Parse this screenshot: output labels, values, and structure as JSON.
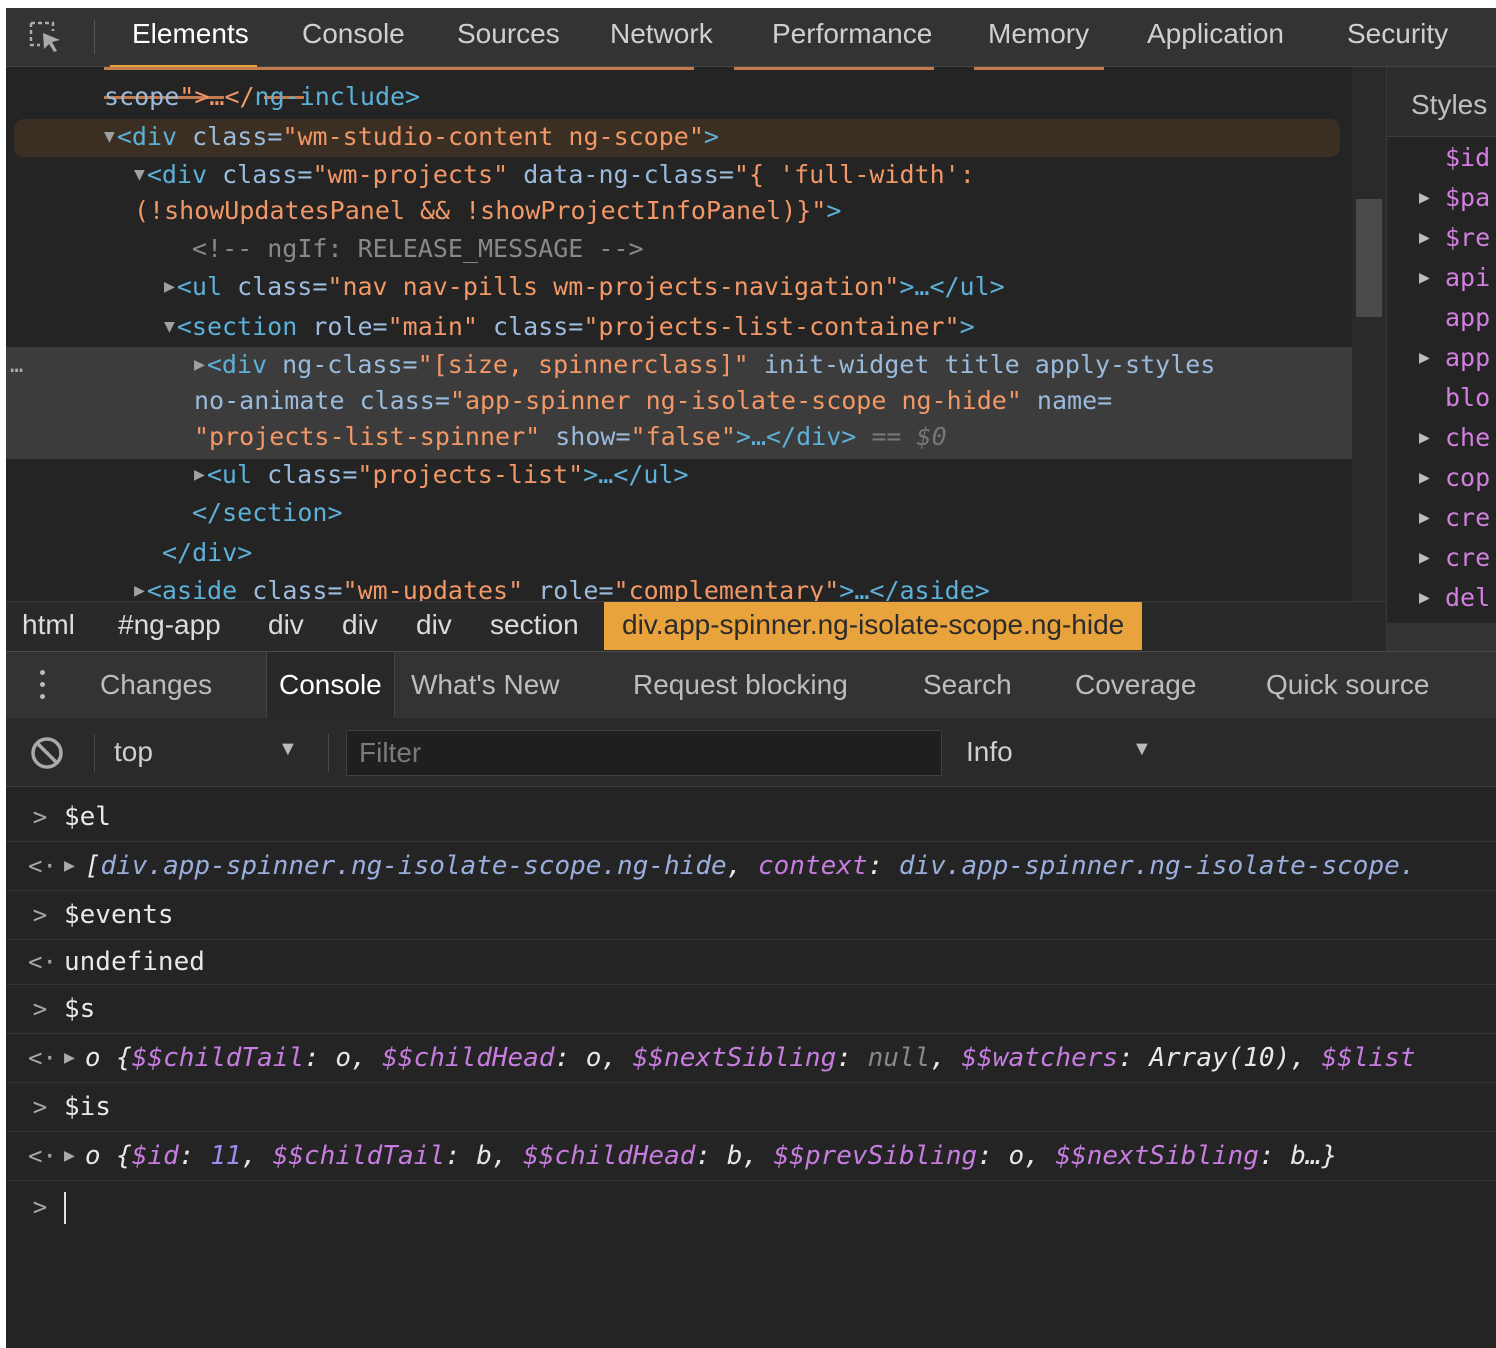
{
  "top_tabs": [
    "Elements",
    "Console",
    "Sources",
    "Network",
    "Performance",
    "Memory",
    "Application",
    "Security"
  ],
  "active_top_tab": "Elements",
  "elements": {
    "line0": {
      "a1": "scope",
      "a2": "\">…</",
      "a3": "ng-include",
      "a4": ">"
    },
    "line1": {
      "open": "<div",
      "attr": "class",
      "value": "\"wm-studio-content ng-scope\"",
      "close": ">"
    },
    "line2": {
      "open": "<div",
      "attr1": "class",
      "value1": "\"wm-projects\"",
      "attr2": "data-ng-class",
      "value2": "\"{ 'full-width':"
    },
    "line3": {
      "value": "(!showUpdatesPanel && !showProjectInfoPanel)}\"",
      "close": ">"
    },
    "line4": {
      "comment": "<!-- ngIf: RELEASE_MESSAGE -->"
    },
    "line5": {
      "open": "<ul",
      "attr": "class",
      "value": "\"nav nav-pills wm-projects-navigation\"",
      "close": ">…</ul>"
    },
    "line6": {
      "open": "<section",
      "attr1": "role",
      "value1": "\"main\"",
      "attr2": "class",
      "value2": "\"projects-list-container\"",
      "close": ">"
    },
    "line7": {
      "open": "<div",
      "attr1": "ng-class",
      "value1": "\"[size, spinnerclass]\"",
      "attrs": "init-widget title apply-styles"
    },
    "line8": {
      "attr1": "no-animate",
      "attr2": "class",
      "value2": "\"app-spinner ng-isolate-scope ng-hide\"",
      "attr3": "name="
    },
    "line9": {
      "value1": "\"projects-list-spinner\"",
      "attr": "show",
      "value2": "\"false\"",
      "close": ">…</div>",
      "marker": "== $0"
    },
    "line10": {
      "open": "<ul",
      "attr": "class",
      "value": "\"projects-list\"",
      "close": ">…</ul>"
    },
    "line11": {
      "text": "</section>"
    },
    "line12": {
      "text": "</div>"
    },
    "line13": {
      "open": "<aside",
      "attr1": "class",
      "value1": "\"wm-updates\"",
      "attr2": "role",
      "value2": "\"complementary\"",
      "close": ">…</aside>"
    },
    "dots": "…"
  },
  "styles_pane": {
    "title": "Styles",
    "items": [
      "$id",
      "$pa",
      "$re",
      "api",
      "app",
      "app",
      "blo",
      "che",
      "cop",
      "cre",
      "cre",
      "del"
    ]
  },
  "breadcrumb": [
    "html",
    "#ng-app",
    "div",
    "div",
    "div",
    "section",
    "div.app-spinner.ng-isolate-scope.ng-hide"
  ],
  "drawer_tabs": [
    "Changes",
    "Console",
    "What's New",
    "Request blocking",
    "Search",
    "Coverage",
    "Quick source"
  ],
  "active_drawer_tab": "Console",
  "console_toolbar": {
    "context": "top",
    "filter_placeholder": "Filter",
    "level": "Info"
  },
  "console": {
    "in1": "$el",
    "out1": {
      "open": "[",
      "v1": "div.app-spinner.ng-isolate-scope.ng-hide",
      "sep1": ", ",
      "k1": "context",
      "colon": ": ",
      "v2": "div.app-spinner.ng-isolate-scope."
    },
    "in2": "$events",
    "out2": "undefined",
    "in3": "$s",
    "out3": {
      "o": "o",
      "brace": " {",
      "k1": "$$childTail",
      "v1": "o",
      "k2": "$$childHead",
      "v2": "o",
      "k3": "$$nextSibling",
      "v3": "null",
      "k4": "$$watchers",
      "v4": "Array(10)",
      "k5": "$$list"
    },
    "in4": "$is",
    "out4": {
      "o": "o",
      "brace": " {",
      "k1": "$id",
      "v1": "11",
      "k2": "$$childTail",
      "v2": "b",
      "k3": "$$childHead",
      "v3": "b",
      "k4": "$$prevSibling",
      "v4": "o",
      "k5": "$$nextSibling",
      "v5": "b…}"
    },
    "prompt": ">"
  }
}
